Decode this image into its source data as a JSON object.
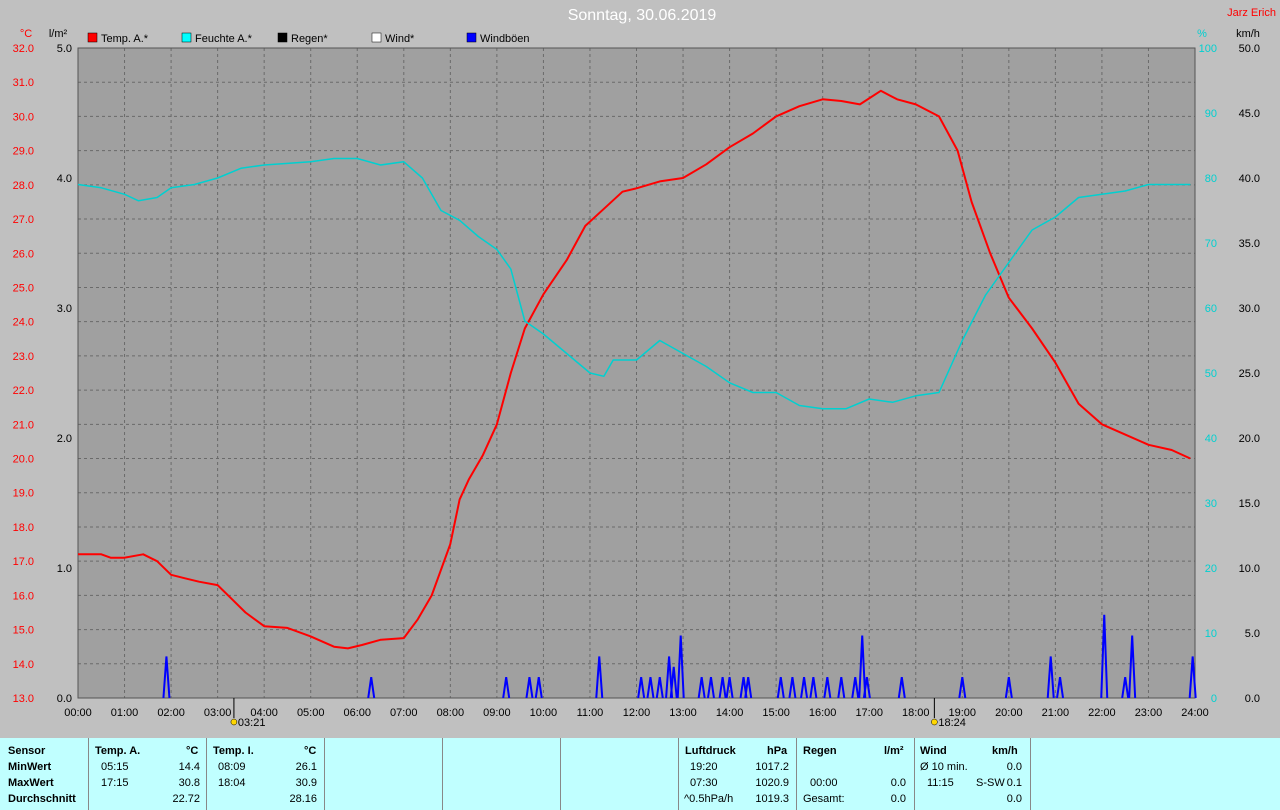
{
  "page_title": "Sonntag, 30.06.2019",
  "owner": "Jarz Erich",
  "units": {
    "left_temp": "°C",
    "left_rain": "l/m²",
    "right_hum": "%",
    "right_wind": "km/h"
  },
  "legend": [
    {
      "label": "Temp. A.*",
      "color": "#ff0000"
    },
    {
      "label": "Feuchte A.*",
      "color": "#00ffff"
    },
    {
      "label": "Regen*",
      "color": "#000000"
    },
    {
      "label": "Wind*",
      "color": "#ffffff"
    },
    {
      "label": "Windböen",
      "color": "#0000ff"
    }
  ],
  "sunrise": "03:21",
  "sunset": "18:24",
  "chart_data": {
    "type": "line",
    "title": "Sonntag, 30.06.2019",
    "x_ticks": [
      "00:00",
      "01:00",
      "02:00",
      "03:00",
      "04:00",
      "05:00",
      "06:00",
      "07:00",
      "08:00",
      "09:00",
      "10:00",
      "11:00",
      "12:00",
      "13:00",
      "14:00",
      "15:00",
      "16:00",
      "17:00",
      "18:00",
      "19:00",
      "20:00",
      "21:00",
      "22:00",
      "23:00",
      "24:00"
    ],
    "axes": {
      "temp": {
        "label": "°C",
        "range": [
          13.0,
          32.0
        ],
        "ticks": [
          "13.0",
          "14.0",
          "15.0",
          "16.0",
          "17.0",
          "18.0",
          "19.0",
          "20.0",
          "21.0",
          "22.0",
          "23.0",
          "24.0",
          "25.0",
          "26.0",
          "27.0",
          "28.0",
          "29.0",
          "30.0",
          "31.0",
          "32.0"
        ]
      },
      "rain": {
        "label": "l/m²",
        "range": [
          0.0,
          5.0
        ],
        "ticks": [
          "0.0",
          "1.0",
          "2.0",
          "3.0",
          "4.0",
          "5.0"
        ]
      },
      "humidity": {
        "label": "%",
        "range": [
          0,
          100
        ],
        "ticks": [
          "0",
          "10",
          "20",
          "30",
          "40",
          "50",
          "60",
          "70",
          "80",
          "90",
          "100"
        ]
      },
      "wind": {
        "label": "km/h",
        "range": [
          0.0,
          50.0
        ],
        "ticks": [
          "0.0",
          "5.0",
          "10.0",
          "15.0",
          "20.0",
          "25.0",
          "30.0",
          "35.0",
          "40.0",
          "45.0",
          "50.0"
        ]
      }
    },
    "grid": true,
    "series": [
      {
        "name": "Temp. A.*",
        "axis": "temp",
        "color": "#ff0000",
        "points": [
          [
            0,
            17.2
          ],
          [
            0.5,
            17.2
          ],
          [
            0.7,
            17.1
          ],
          [
            1.0,
            17.1
          ],
          [
            1.4,
            17.2
          ],
          [
            1.7,
            17.0
          ],
          [
            2.0,
            16.6
          ],
          [
            2.3,
            16.5
          ],
          [
            2.6,
            16.4
          ],
          [
            3.0,
            16.3
          ],
          [
            3.3,
            15.9
          ],
          [
            3.6,
            15.5
          ],
          [
            4.0,
            15.1
          ],
          [
            4.5,
            15.05
          ],
          [
            5.0,
            14.8
          ],
          [
            5.5,
            14.5
          ],
          [
            5.8,
            14.45
          ],
          [
            6.1,
            14.55
          ],
          [
            6.5,
            14.7
          ],
          [
            7.0,
            14.75
          ],
          [
            7.3,
            15.3
          ],
          [
            7.6,
            16.0
          ],
          [
            8.0,
            17.5
          ],
          [
            8.2,
            18.8
          ],
          [
            8.4,
            19.4
          ],
          [
            8.7,
            20.1
          ],
          [
            9.0,
            21.0
          ],
          [
            9.3,
            22.5
          ],
          [
            9.6,
            23.8
          ],
          [
            10.0,
            24.8
          ],
          [
            10.5,
            25.8
          ],
          [
            10.9,
            26.8
          ],
          [
            11.3,
            27.3
          ],
          [
            11.7,
            27.8
          ],
          [
            12.0,
            27.9
          ],
          [
            12.5,
            28.1
          ],
          [
            13.0,
            28.2
          ],
          [
            13.5,
            28.6
          ],
          [
            14.0,
            29.1
          ],
          [
            14.5,
            29.5
          ],
          [
            15.0,
            30.0
          ],
          [
            15.5,
            30.3
          ],
          [
            16.0,
            30.5
          ],
          [
            16.4,
            30.45
          ],
          [
            16.8,
            30.35
          ],
          [
            17.25,
            30.75
          ],
          [
            17.6,
            30.5
          ],
          [
            18.0,
            30.35
          ],
          [
            18.5,
            30.0
          ],
          [
            18.9,
            29.0
          ],
          [
            19.2,
            27.5
          ],
          [
            19.6,
            26.0
          ],
          [
            20.0,
            24.7
          ],
          [
            20.5,
            23.8
          ],
          [
            21.0,
            22.8
          ],
          [
            21.5,
            21.6
          ],
          [
            22.0,
            21.0
          ],
          [
            22.5,
            20.7
          ],
          [
            23.0,
            20.4
          ],
          [
            23.5,
            20.25
          ],
          [
            23.9,
            20.0
          ]
        ]
      },
      {
        "name": "Feuchte A.*",
        "axis": "humidity",
        "color": "#00d0d0",
        "points": [
          [
            0,
            79
          ],
          [
            0.5,
            78.5
          ],
          [
            1.0,
            77.5
          ],
          [
            1.3,
            76.5
          ],
          [
            1.7,
            77
          ],
          [
            2.0,
            78.5
          ],
          [
            2.5,
            79
          ],
          [
            3.0,
            80
          ],
          [
            3.5,
            81.5
          ],
          [
            4.0,
            82
          ],
          [
            5.0,
            82.5
          ],
          [
            5.5,
            83
          ],
          [
            6.0,
            83
          ],
          [
            6.5,
            82
          ],
          [
            7.0,
            82.5
          ],
          [
            7.4,
            80
          ],
          [
            7.8,
            75
          ],
          [
            8.2,
            73.5
          ],
          [
            8.6,
            71
          ],
          [
            9.0,
            69
          ],
          [
            9.3,
            66
          ],
          [
            9.6,
            58
          ],
          [
            10.0,
            56
          ],
          [
            10.5,
            53
          ],
          [
            11.0,
            50
          ],
          [
            11.3,
            49.5
          ],
          [
            11.5,
            52
          ],
          [
            12.0,
            52
          ],
          [
            12.5,
            55
          ],
          [
            13.0,
            53
          ],
          [
            13.5,
            51
          ],
          [
            14.0,
            48.5
          ],
          [
            14.5,
            47
          ],
          [
            15.0,
            47
          ],
          [
            15.5,
            45
          ],
          [
            16.0,
            44.5
          ],
          [
            16.5,
            44.5
          ],
          [
            17.0,
            46
          ],
          [
            17.5,
            45.5
          ],
          [
            18.0,
            46.5
          ],
          [
            18.5,
            47
          ],
          [
            19.0,
            55
          ],
          [
            19.5,
            62
          ],
          [
            20.0,
            67
          ],
          [
            20.5,
            72
          ],
          [
            21.0,
            74
          ],
          [
            21.5,
            77
          ],
          [
            22.0,
            77.5
          ],
          [
            22.5,
            78
          ],
          [
            23.0,
            79
          ],
          [
            23.9,
            79
          ]
        ]
      },
      {
        "name": "Windböen",
        "axis": "wind",
        "color": "#0000ff",
        "kind": "spikes",
        "points": [
          [
            1.9,
            3.2
          ],
          [
            6.3,
            1.6
          ],
          [
            9.2,
            1.6
          ],
          [
            9.7,
            1.6
          ],
          [
            9.9,
            1.6
          ],
          [
            11.2,
            3.2
          ],
          [
            12.1,
            1.6
          ],
          [
            12.3,
            1.6
          ],
          [
            12.5,
            1.6
          ],
          [
            12.7,
            3.2
          ],
          [
            12.8,
            2.4
          ],
          [
            12.95,
            4.8
          ],
          [
            13.4,
            1.6
          ],
          [
            13.6,
            1.6
          ],
          [
            13.85,
            1.6
          ],
          [
            14.0,
            1.6
          ],
          [
            14.3,
            1.6
          ],
          [
            14.4,
            1.6
          ],
          [
            15.1,
            1.6
          ],
          [
            15.35,
            1.6
          ],
          [
            15.6,
            1.6
          ],
          [
            15.8,
            1.6
          ],
          [
            16.1,
            1.6
          ],
          [
            16.4,
            1.6
          ],
          [
            16.7,
            1.6
          ],
          [
            16.85,
            4.8
          ],
          [
            16.95,
            1.6
          ],
          [
            17.7,
            1.6
          ],
          [
            19.0,
            1.6
          ],
          [
            20.0,
            1.6
          ],
          [
            20.9,
            3.2
          ],
          [
            21.1,
            1.6
          ],
          [
            22.05,
            6.4
          ],
          [
            22.5,
            1.6
          ],
          [
            22.65,
            4.8
          ],
          [
            23.95,
            3.2
          ]
        ]
      }
    ]
  },
  "stats": {
    "sensor": {
      "title": "Sensor",
      "rows": [
        "MinWert",
        "MaxWert",
        "Durchschnitt"
      ]
    },
    "temp_a": {
      "title": "Temp. A.",
      "unit": "°C",
      "min_time": "05:15",
      "min_val": "14.4",
      "max_time": "17:15",
      "max_val": "30.8",
      "avg": "22.72"
    },
    "temp_i": {
      "title": "Temp. I.",
      "unit": "°C",
      "min_time": "08:09",
      "min_val": "26.1",
      "max_time": "18:04",
      "max_val": "30.9",
      "avg": "28.16"
    },
    "pressure": {
      "title": "Luftdruck",
      "unit": "hPa",
      "min_time": "19:20",
      "min_val": "1017.2",
      "max_time": "07:30",
      "max_val": "1020.9",
      "avg_label": "^0.5hPa/h",
      "avg": "1019.3"
    },
    "rain": {
      "title": "Regen",
      "unit": "l/m²",
      "max_time": "00:00",
      "max_val": "0.0",
      "total_label": "Gesamt:",
      "total": "0.0"
    },
    "wind": {
      "title": "Wind",
      "unit": "km/h",
      "avg_label": "Ø 10 min.",
      "avg_val": "0.0",
      "max_time": "11:15",
      "max_dir": "S-SW",
      "max_val": "0.1",
      "extra": "0.0"
    }
  }
}
